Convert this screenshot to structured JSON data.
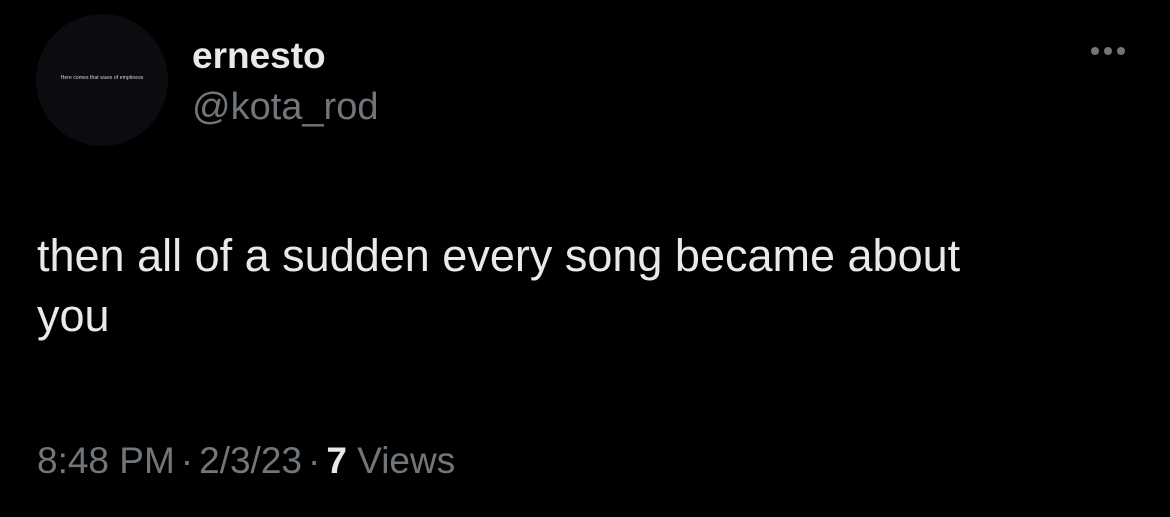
{
  "user": {
    "display_name": "ernesto",
    "handle": "@kota_rod",
    "avatar_text": "Here comes that wave of emptiness"
  },
  "tweet": {
    "text": "then all of a sudden every song became about\nyou"
  },
  "meta": {
    "time": "8:48 PM",
    "separator": "·",
    "date": "2/3/23",
    "views_count": "7",
    "views_label": "Views"
  },
  "icons": {
    "more": "more-horizontal-icon"
  },
  "colors": {
    "background": "#000000",
    "primary_text": "#e7e9ea",
    "secondary_text": "#71767b"
  }
}
